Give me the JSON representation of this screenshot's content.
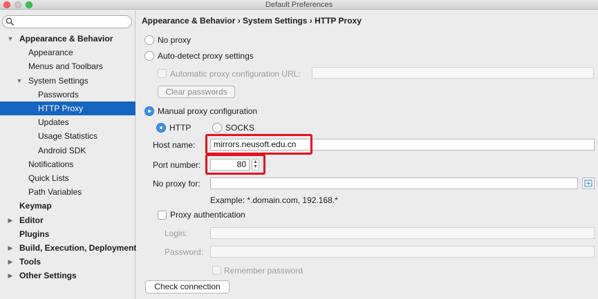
{
  "window": {
    "title": "Default Preferences"
  },
  "sidebar": {
    "search_placeholder": "",
    "items": [
      {
        "label": "Appearance & Behavior",
        "level": 0,
        "expanded": true
      },
      {
        "label": "Appearance",
        "level": 1
      },
      {
        "label": "Menus and Toolbars",
        "level": 1
      },
      {
        "label": "System Settings",
        "level": 1,
        "expanded": true
      },
      {
        "label": "Passwords",
        "level": 2
      },
      {
        "label": "HTTP Proxy",
        "level": 2,
        "selected": true
      },
      {
        "label": "Updates",
        "level": 2
      },
      {
        "label": "Usage Statistics",
        "level": 2
      },
      {
        "label": "Android SDK",
        "level": 2
      },
      {
        "label": "Notifications",
        "level": 1
      },
      {
        "label": "Quick Lists",
        "level": 1
      },
      {
        "label": "Path Variables",
        "level": 1
      },
      {
        "label": "Keymap",
        "level": 0
      },
      {
        "label": "Editor",
        "level": 0,
        "collapsed": true
      },
      {
        "label": "Plugins",
        "level": 0
      },
      {
        "label": "Build, Execution, Deployment",
        "level": 0,
        "collapsed": true
      },
      {
        "label": "Tools",
        "level": 0,
        "collapsed": true
      },
      {
        "label": "Other Settings",
        "level": 0,
        "collapsed": true
      }
    ]
  },
  "content": {
    "breadcrumb": "Appearance & Behavior › System Settings › HTTP Proxy",
    "no_proxy_label": "No proxy",
    "auto_detect_label": "Auto-detect proxy settings",
    "auto_config_url_label": "Automatic proxy configuration URL:",
    "auto_config_url_value": "",
    "clear_passwords_label": "Clear passwords",
    "manual_label": "Manual proxy configuration",
    "http_label": "HTTP",
    "socks_label": "SOCKS",
    "host_label": "Host name:",
    "host_value": "mirrors.neusoft.edu.cn",
    "port_label": "Port number:",
    "port_value": "80",
    "no_proxy_for_label": "No proxy for:",
    "no_proxy_for_value": "",
    "example_text": "Example: *.domain.com, 192.168.*",
    "proxy_auth_label": "Proxy authentication",
    "login_label": "Login:",
    "login_value": "",
    "password_label": "Password:",
    "password_value": "",
    "remember_password_label": "Remember password",
    "check_connection_label": "Check connection"
  },
  "colors": {
    "selection": "#1565c0",
    "highlight": "#e8101b",
    "radio_on": "#3d8fee"
  },
  "icons": {
    "search": "search-icon",
    "expand_field": "expand-field-icon"
  }
}
